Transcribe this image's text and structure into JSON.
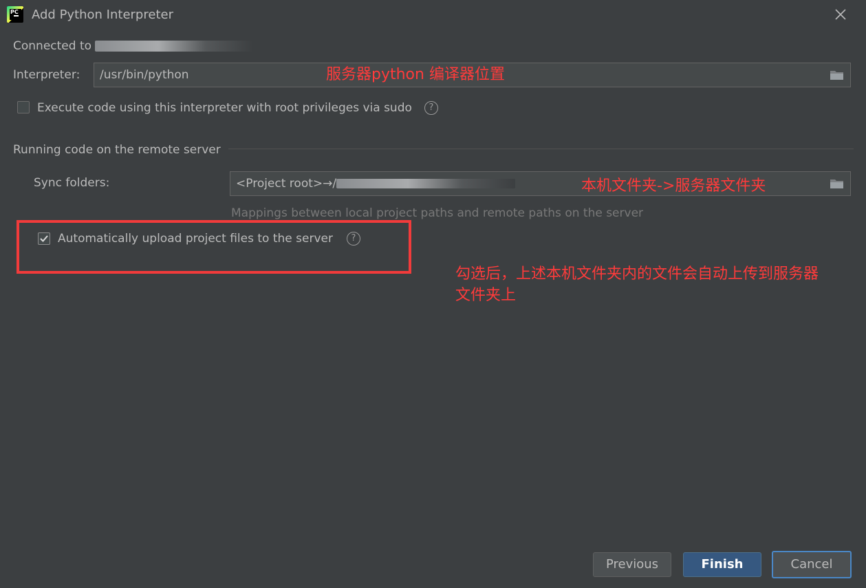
{
  "window": {
    "title": "Add Python Interpreter"
  },
  "connection": {
    "label": "Connected to "
  },
  "interpreter": {
    "label": "Interpreter:",
    "value": "/usr/bin/python"
  },
  "sudo": {
    "label": "Execute code using this interpreter with root privileges via sudo",
    "checked": false
  },
  "remote_section": {
    "heading": "Running code on the remote server"
  },
  "sync": {
    "label": "Sync folders:",
    "value": "<Project root>→/",
    "hint": "Mappings between local project paths and remote paths on the server"
  },
  "auto_upload": {
    "label": "Automatically upload project files to the server",
    "checked": true
  },
  "annotations": {
    "interpreter_note": "服务器python 编译器位置",
    "sync_note": "本机文件夹->服务器文件夹",
    "upload_note_line1": "勾选后，上述本机文件夹内的文件会自动上传到服务器",
    "upload_note_line2": "文件夹上"
  },
  "buttons": {
    "previous": "Previous",
    "finish": "Finish",
    "cancel": "Cancel"
  },
  "icons": {
    "logo": "pycharm-logo-icon",
    "close": "close-icon",
    "folder": "folder-icon",
    "help": "help-icon",
    "check": "checkmark-icon"
  },
  "colors": {
    "background": "#3c3f41",
    "accent": "#365880",
    "annotation": "#ff3b3b",
    "focus": "#4a88c7"
  }
}
